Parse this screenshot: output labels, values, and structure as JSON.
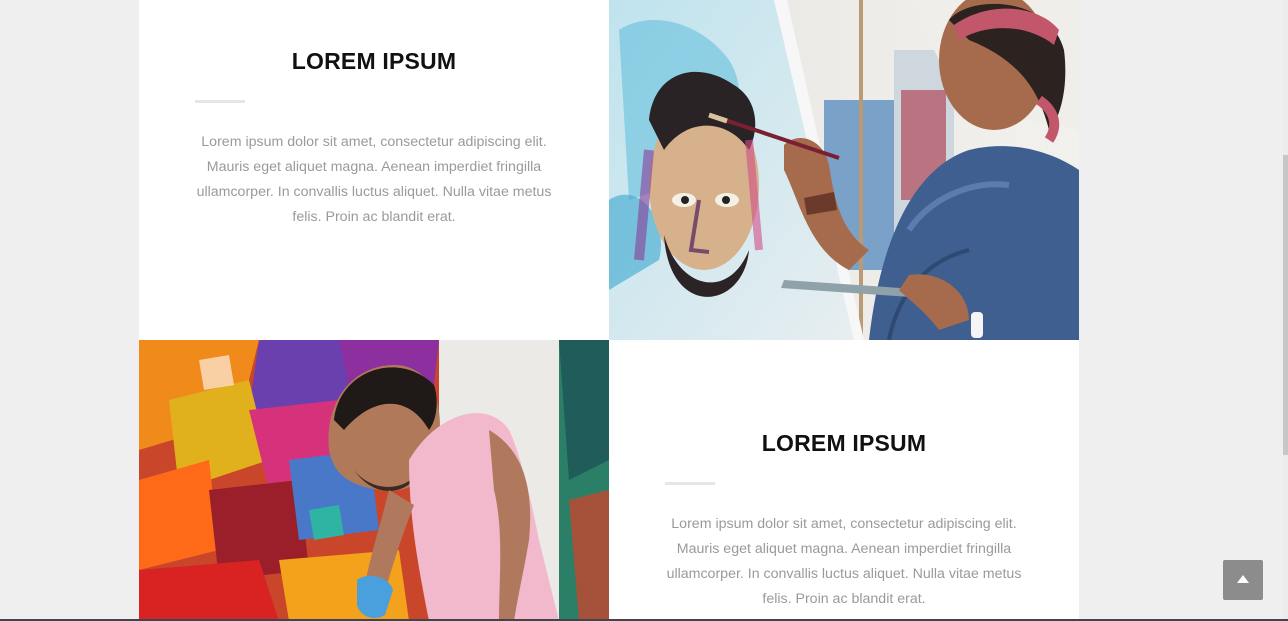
{
  "section_top": {
    "title": "LOREM IPSUM",
    "body": "Lorem ipsum dolor sit amet, consectetur adipiscing elit. Mauris eget aliquet magna. Aenean imperdiet fringilla ullamcorper. In convallis luctus aliquet. Nulla vitae metus felis. Proin ac blandit erat.",
    "image_icon": "woman-painting-portrait-photo"
  },
  "section_bottom": {
    "title": "LOREM IPSUM",
    "body": "Lorem ipsum dolor sit amet, consectetur adipiscing elit. Mauris eget aliquet magna. Aenean imperdiet fringilla ullamcorper. In convallis luctus aliquet. Nulla vitae metus felis. Proin ac blandit erat.",
    "image_icon": "man-painting-abstract-photo"
  },
  "controls": {
    "back_to_top_icon": "chevron-up-icon"
  },
  "colors": {
    "page_background": "#efefef",
    "card_background": "#ffffff",
    "heading": "#111111",
    "body_text": "#9a9a9a",
    "divider": "#e6e6e6",
    "back_to_top": "#8c8c8c"
  }
}
